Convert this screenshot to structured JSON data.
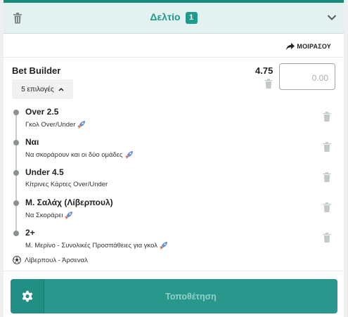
{
  "header": {
    "title": "Δελτίο",
    "count": "1",
    "accent_color": "#1f9b8d"
  },
  "share": {
    "label": "ΜΟΙΡΑΣΟΥ"
  },
  "bet": {
    "title": "Bet Builder",
    "odds": "4.75",
    "stake_placeholder": "0.00",
    "selections_toggle": "5 επιλογές",
    "legs": [
      {
        "pick": "Over 2.5",
        "market": "Γκολ Over/Under",
        "boosted": true
      },
      {
        "pick": "Ναι",
        "market": "Να σκοράρουν και οι δύο ομάδες",
        "boosted": true
      },
      {
        "pick": "Under 4.5",
        "market": "Κίτρινες Κάρτες Over/Under",
        "boosted": false
      },
      {
        "pick": "Μ. Σαλάχ (Λίβερπουλ)",
        "market": "Να Σκοράρει",
        "boosted": true
      },
      {
        "pick": "2+",
        "market": "Μ. Μερίνο - Συνολικές Προσπάθειες για γκολ",
        "boosted": true
      }
    ],
    "match": "Λίβερπουλ - Άρσεναλ"
  },
  "footer": {
    "place_label": "Τοποθέτηση",
    "button_color": "#2a978c"
  }
}
